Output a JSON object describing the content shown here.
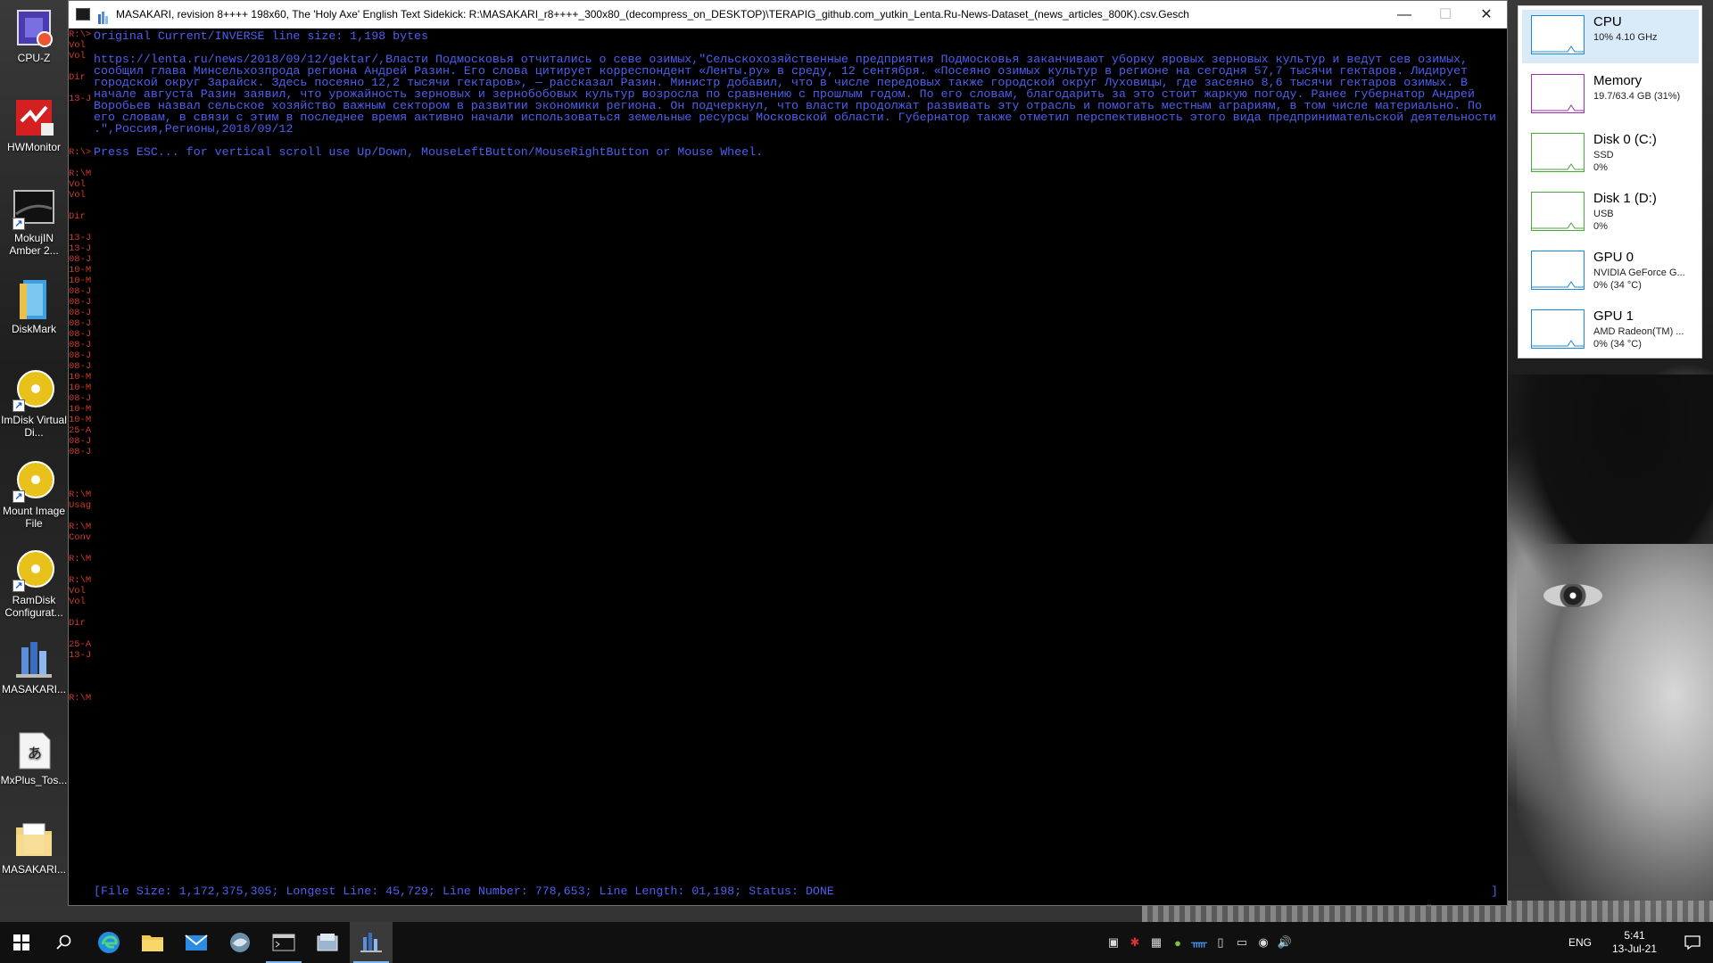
{
  "desktop": {
    "icons": [
      {
        "label": "CPU-Z"
      },
      {
        "label": "HWMonitor"
      },
      {
        "label": "MokujIN Amber 2..."
      },
      {
        "label": "DiskMark"
      },
      {
        "label": "ImDisk Virtual Di..."
      },
      {
        "label": "Mount Image File"
      },
      {
        "label": "RamDisk Configurat..."
      },
      {
        "label": "MASAKARI..."
      },
      {
        "label": "MxPlus_Tos..."
      },
      {
        "label": "MASAKARI..."
      }
    ]
  },
  "console": {
    "title": "MASAKARI, revision 8++++ 198x60, The 'Holy Axe' English Text Sidekick: R:\\MASAKARI_r8++++_300x80_(decompress_on_DESKTOP)\\TERAPIG_github.com_yutkin_Lenta.Ru-News-Dataset_(news_articles_800K).csv.Gesch",
    "left_pane_lines": [
      "R:\\>",
      "Vol",
      "Vol",
      "",
      "Dir",
      "",
      "13-J",
      "",
      "",
      "",
      "",
      "R:\\>",
      "",
      "R:\\M",
      "Vol",
      "Vol",
      "",
      "Dir",
      "",
      "13-J",
      "13-J",
      "08-J",
      "10-M",
      "10-M",
      "08-J",
      "08-J",
      "08-J",
      "08-J",
      "08-J",
      "08-J",
      "08-J",
      "08-J",
      "10-M",
      "10-M",
      "08-J",
      "10-M",
      "10-M",
      "25-A",
      "08-J",
      "08-J",
      "",
      "",
      "",
      "R:\\M",
      "Usag",
      "",
      "R:\\M",
      "Conv",
      "",
      "R:\\M",
      "",
      "R:\\M",
      "Vol",
      "Vol",
      "",
      "Dir",
      "",
      "25-A",
      "13-J",
      "",
      "",
      "",
      "R:\\M"
    ],
    "lines": [
      "Original Current/INVERSE line size: 1,198 bytes",
      "",
      "https://lenta.ru/news/2018/09/12/gektar/,Власти Подмосковья отчитались о севе озимых,\"Сельскохозяйственные предприятия Подмосковья заканчивают уборку яровых зерновых культур и ведут сев озимых,",
      "сообщил глава Минсельхозпрода региона Андрей Разин. Его слова цитирует корреспондент «Ленты.ру» в среду, 12 сентября. «Посеяно озимых культур в регионе на сегодня 57,7 тысячи гектаров. Лидирует",
      "городской округ Зарайск. Здесь посеяно 12,2 тысячи гектаров», — рассказал Разин. Министр добавил, что в числе передовых также городской округ Луховицы, где засеяно 8,6 тысячи гектаров озимых. В",
      "начале августа Разин заявил, что урожайность зерновых и зернобобовых культур возросла по сравнению с прошлым годом. По его словам, благодарить за это стоит жаркую погоду. Ранее губернатор Андрей",
      "Воробьев назвал сельское хозяйство важным сектором в развитии экономики региона. Он подчеркнул, что власти продолжат развивать эту отрасль и помогать местным аграриям, в том числе материально. По",
      "его словам, в связи с этим в последнее время активно начали использоваться земельные ресурсы Московской области. Губернатор также отметил перспективность этого вида предпринимательской деятельности",
      ".\",Россия,Регионы,2018/09/12",
      "",
      "Press ESC... for vertical scroll use Up/Down, MouseLeftButton/MouseRightButton or Mouse Wheel."
    ],
    "status": "[File Size: 1,172,375,305; Longest Line: 45,729; Line Number: 778,653; Line Length: 01,198; Status: DONE",
    "status_close": "]"
  },
  "perf": {
    "items": [
      {
        "title": "CPU",
        "sub1": "10% 4.10 GHz",
        "sub2": "",
        "color": "#1a8ad8"
      },
      {
        "title": "Memory",
        "sub1": "19.7/63.4 GB (31%)",
        "sub2": "",
        "color": "#9b2fae"
      },
      {
        "title": "Disk 0 (C:)",
        "sub1": "SSD",
        "sub2": "0%",
        "color": "#4aa53a"
      },
      {
        "title": "Disk 1 (D:)",
        "sub1": "USB",
        "sub2": "0%",
        "color": "#4aa53a"
      },
      {
        "title": "GPU 0",
        "sub1": "NVIDIA GeForce G...",
        "sub2": "0% (34 °C)",
        "color": "#1a8ad8"
      },
      {
        "title": "GPU 1",
        "sub1": "AMD Radeon(TM) ...",
        "sub2": "0% (34 °C)",
        "color": "#1a8ad8"
      }
    ]
  },
  "taskbar": {
    "lang": "ENG",
    "time": "5:41",
    "date": "13-Jul-21"
  },
  "colors": {
    "console_text": "#4d5ff0",
    "left_pane_text": "#d23a2a",
    "taskbar_bg": "#101010"
  }
}
